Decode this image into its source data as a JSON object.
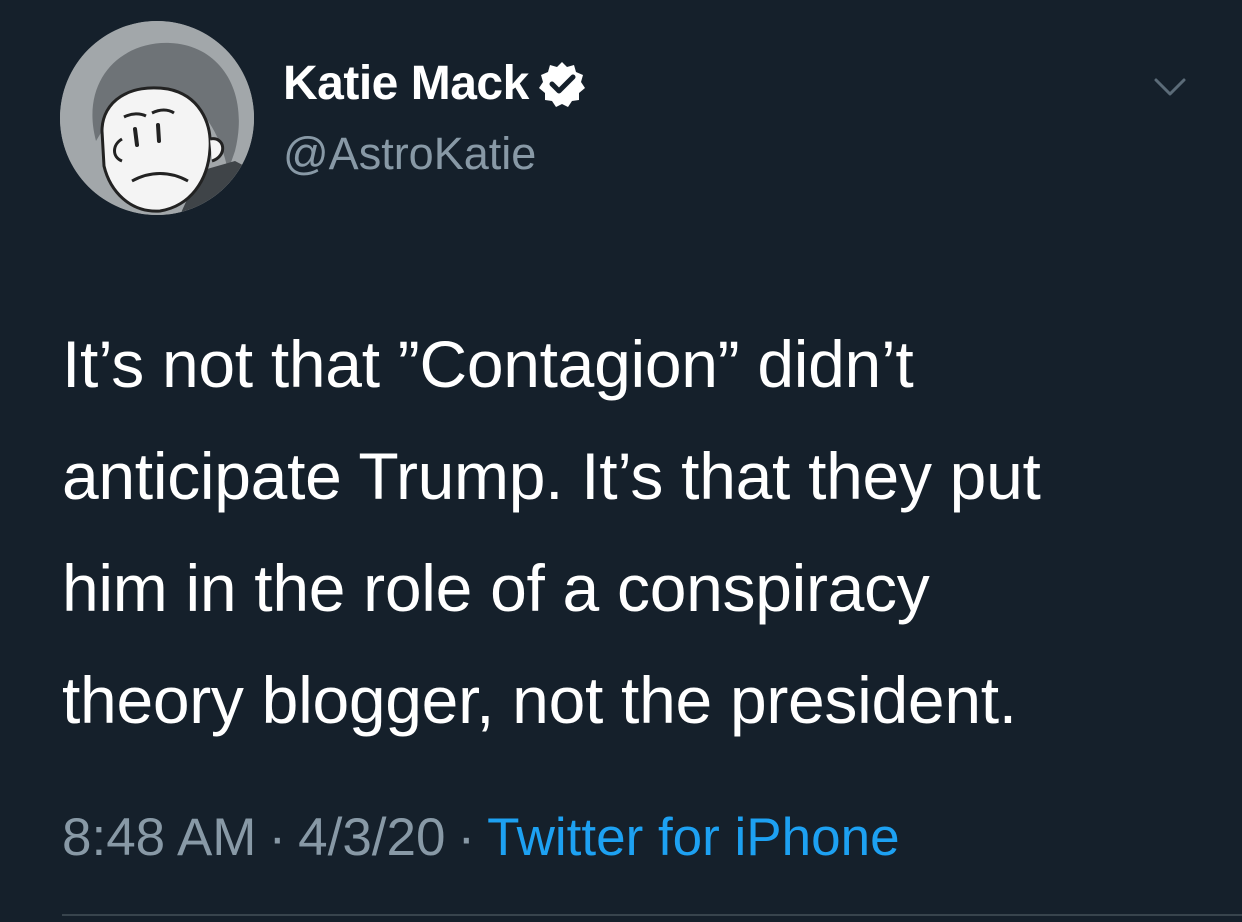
{
  "author": {
    "display_name": "Katie Mack",
    "handle": "@AstroKatie",
    "verified": true,
    "avatar": "cartoon-portrait"
  },
  "tweet": {
    "lines": [
      "It’s not that ”Contagion” didn’t",
      "anticipate Trump. It’s that they put",
      "him in the role of a conspiracy",
      "theory blogger, not the president."
    ]
  },
  "meta": {
    "time": "8:48 AM",
    "separator": "·",
    "date": "4/3/20",
    "source": "Twitter for iPhone"
  },
  "icons": {
    "menu": "chevron-down-icon",
    "verified": "verified-badge-icon"
  },
  "colors": {
    "background": "#15202b",
    "secondary_text": "#8899a6",
    "link": "#1da1f2",
    "divider": "#38444d"
  }
}
